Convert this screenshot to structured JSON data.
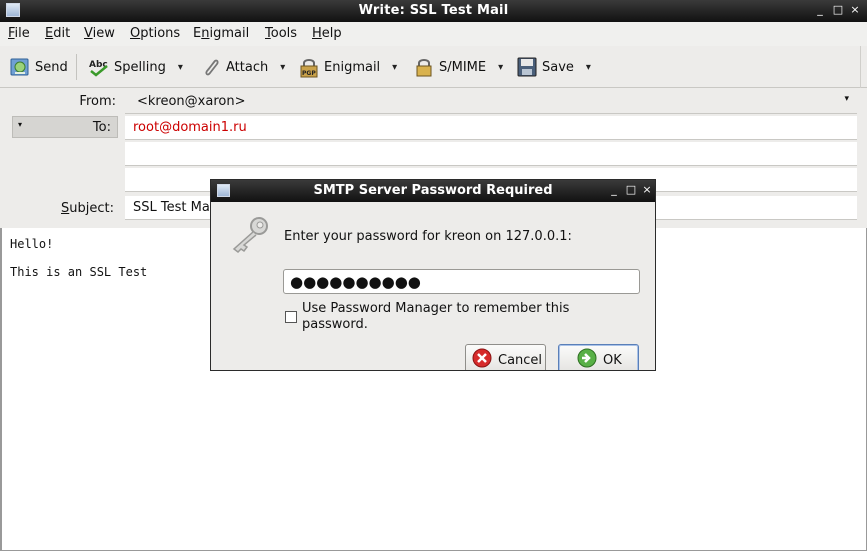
{
  "window": {
    "title": "Write: SSL Test Mail",
    "controls": [
      "_",
      "□",
      "×"
    ]
  },
  "menu": {
    "file": {
      "u": "F",
      "rest": "ile"
    },
    "edit": {
      "u": "E",
      "rest": "dit"
    },
    "view": {
      "u": "V",
      "rest": "iew"
    },
    "options": {
      "u": "O",
      "rest": "ptions"
    },
    "enigmail": {
      "pre": "E",
      "u": "n",
      "rest": "igmail"
    },
    "tools": {
      "u": "T",
      "rest": "ools"
    },
    "help": {
      "u": "H",
      "rest": "elp"
    }
  },
  "toolbar": {
    "send": "Send",
    "spelling": "Spelling",
    "attach": "Attach",
    "enigmail": "Enigmail",
    "smime": "S/MIME",
    "save": "Save",
    "caret": "▾",
    "spelling_icon_text": "Abc",
    "enigmail_icon_text": "PGP"
  },
  "header": {
    "from_label": "From:",
    "from_value": "<kreon@xaron>",
    "to_label": "To:",
    "to_value": "root@domain1.ru",
    "subject_label": "Subject:",
    "subject_value": "SSL Test Ma"
  },
  "body": {
    "line1": "Hello!",
    "line2": "This is an SSL Test"
  },
  "dialog": {
    "title": "SMTP Server Password Required",
    "controls": [
      "_",
      "□",
      "×"
    ],
    "prompt": "Enter your password for kreon on 127.0.0.1:",
    "password_masked": "●●●●●●●●●●",
    "checkbox_label": "Use Password Manager to remember this password.",
    "cancel": "Cancel",
    "ok": "OK"
  },
  "colors": {
    "to_value": "#cc0000",
    "titlebar": "#1a1a1a",
    "cancel_icon": "#d62b2b",
    "ok_icon": "#4aa03a"
  }
}
